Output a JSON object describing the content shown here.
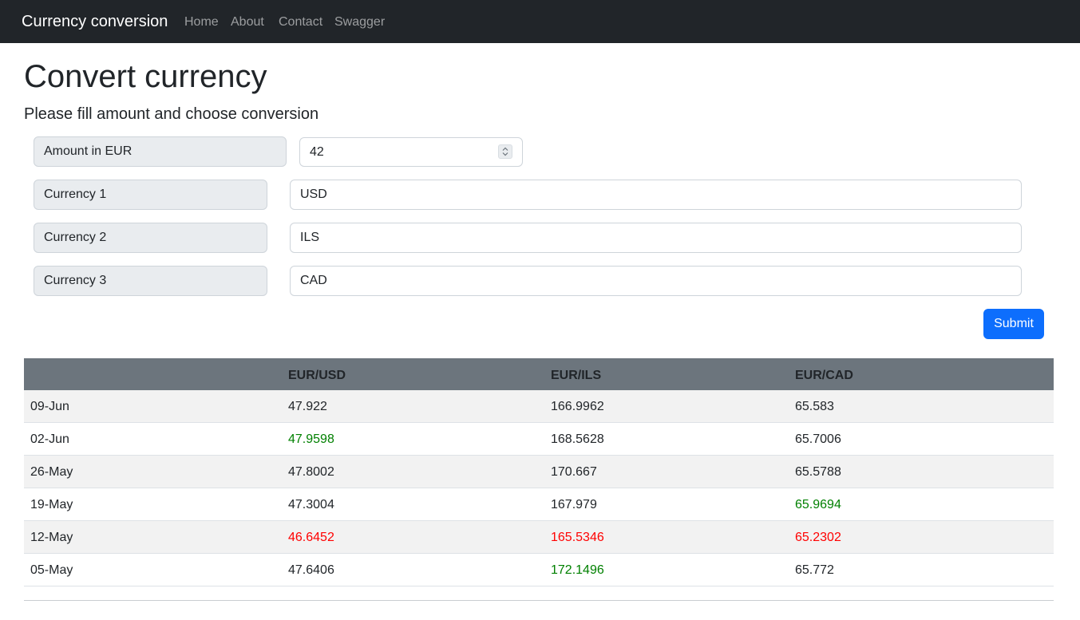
{
  "navbar": {
    "brand": "Currency conversion",
    "links": [
      "Home",
      "About",
      "Contact",
      "Swagger"
    ]
  },
  "page": {
    "title": "Convert currency",
    "lead": "Please fill amount and choose conversion"
  },
  "form": {
    "amount_label": "Amount in EUR",
    "amount_value": "42",
    "currencies": [
      {
        "label": "Currency 1",
        "value": "USD"
      },
      {
        "label": "Currency 2",
        "value": "ILS"
      },
      {
        "label": "Currency 3",
        "value": "CAD"
      }
    ],
    "submit_label": "Submit"
  },
  "colors": {
    "up": "#008000",
    "down": "#ff0000",
    "normal": "#212529"
  },
  "table": {
    "headers": [
      "",
      "EUR/USD",
      "EUR/ILS",
      "EUR/CAD"
    ],
    "rows": [
      {
        "date": "09-Jun",
        "cells": [
          {
            "v": "47.922",
            "s": "normal"
          },
          {
            "v": "166.9962",
            "s": "normal"
          },
          {
            "v": "65.583",
            "s": "normal"
          }
        ]
      },
      {
        "date": "02-Jun",
        "cells": [
          {
            "v": "47.9598",
            "s": "up"
          },
          {
            "v": "168.5628",
            "s": "normal"
          },
          {
            "v": "65.7006",
            "s": "normal"
          }
        ]
      },
      {
        "date": "26-May",
        "cells": [
          {
            "v": "47.8002",
            "s": "normal"
          },
          {
            "v": "170.667",
            "s": "normal"
          },
          {
            "v": "65.5788",
            "s": "normal"
          }
        ]
      },
      {
        "date": "19-May",
        "cells": [
          {
            "v": "47.3004",
            "s": "normal"
          },
          {
            "v": "167.979",
            "s": "normal"
          },
          {
            "v": "65.9694",
            "s": "up"
          }
        ]
      },
      {
        "date": "12-May",
        "cells": [
          {
            "v": "46.6452",
            "s": "down"
          },
          {
            "v": "165.5346",
            "s": "down"
          },
          {
            "v": "65.2302",
            "s": "down"
          }
        ]
      },
      {
        "date": "05-May",
        "cells": [
          {
            "v": "47.6406",
            "s": "normal"
          },
          {
            "v": "172.1496",
            "s": "up"
          },
          {
            "v": "65.772",
            "s": "normal"
          }
        ]
      }
    ]
  }
}
